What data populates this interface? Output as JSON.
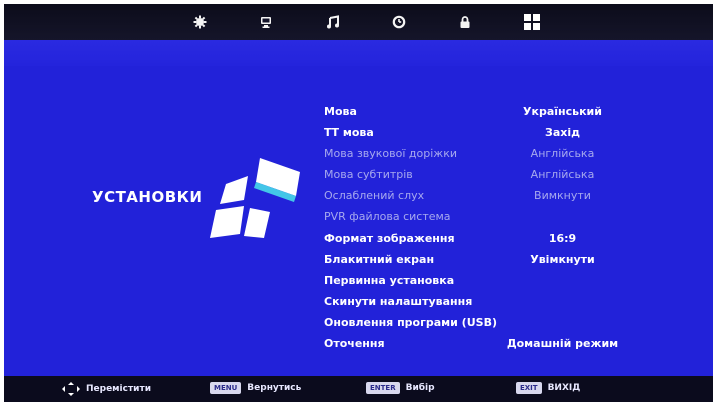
{
  "topbar": {
    "icons": [
      {
        "name": "picture-icon"
      },
      {
        "name": "tv-icon"
      },
      {
        "name": "music-icon"
      },
      {
        "name": "timer-icon"
      },
      {
        "name": "lock-icon"
      },
      {
        "name": "setup-icon",
        "selected": true
      }
    ]
  },
  "section": {
    "title": "УСТАНОВКИ"
  },
  "menu": {
    "items": [
      {
        "label": "Мова",
        "value": "Український",
        "enabled": true
      },
      {
        "label": "ТТ мова",
        "value": "Захід",
        "enabled": true
      },
      {
        "label": "Мова звукової доріжки",
        "value": "Англійська",
        "enabled": false
      },
      {
        "label": "Мова субтитрів",
        "value": "Англійська",
        "enabled": false
      },
      {
        "label": "Ослаблений слух",
        "value": "Вимкнути",
        "enabled": false
      },
      {
        "label": "PVR файлова система",
        "value": "",
        "enabled": false
      },
      {
        "label": "Формат зображення",
        "value": "16:9",
        "enabled": true
      },
      {
        "label": "Блакитний екран",
        "value": "Увімкнути",
        "enabled": true
      },
      {
        "label": "Первинна установка",
        "value": "",
        "enabled": true
      },
      {
        "label": "Скинути налаштування",
        "value": "",
        "enabled": true
      },
      {
        "label": "Оновлення програми (USB)",
        "value": "",
        "enabled": true
      },
      {
        "label": "Оточення",
        "value": "Домашній режим",
        "enabled": true
      }
    ]
  },
  "bottombar": {
    "move": {
      "text": "Перемістити"
    },
    "back": {
      "key": "MENU",
      "text": "Вернутись"
    },
    "select": {
      "key": "ENTER",
      "text": "Вибір"
    },
    "exit": {
      "key": "EXIT",
      "text": "ВИХІД"
    }
  },
  "colors": {
    "background": "#2222d9",
    "topbar": "#0c0c1a",
    "bottombar": "#0b0b1d",
    "text_active": "#ffffff",
    "text_disabled": "#a7a9ee"
  }
}
